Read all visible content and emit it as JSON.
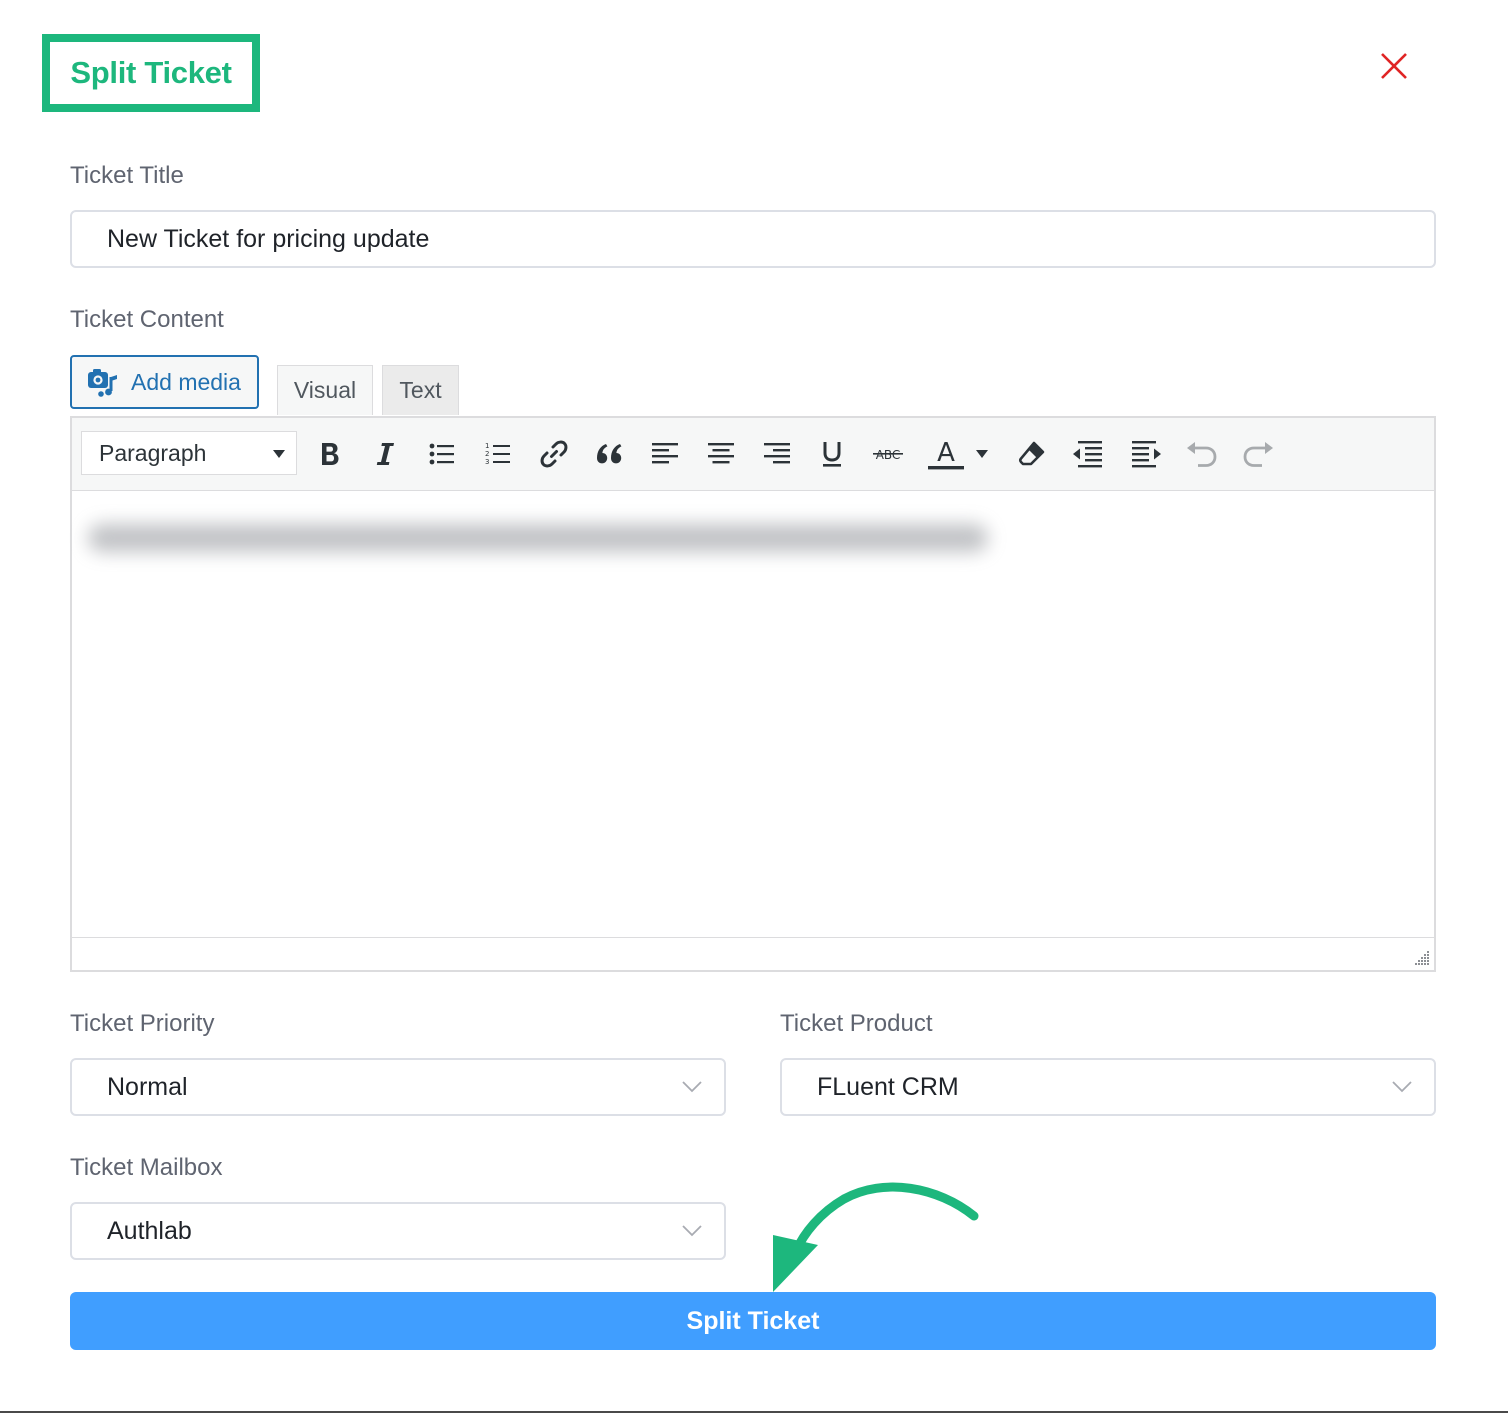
{
  "dialog": {
    "title": "Split Ticket",
    "close_icon": "close-icon",
    "accent_color": "#1db77d",
    "close_color": "#e02424"
  },
  "form": {
    "ticket_title": {
      "label": "Ticket Title",
      "value": "New Ticket for pricing update"
    },
    "ticket_content": {
      "label": "Ticket Content",
      "add_media_label": "Add media",
      "tabs": [
        {
          "label": "Visual",
          "active": true
        },
        {
          "label": "Text",
          "active": false
        }
      ],
      "format_select": {
        "value": "Paragraph"
      },
      "toolbar_icons": [
        "bold-icon",
        "italic-icon",
        "bulleted-list-icon",
        "numbered-list-icon",
        "link-icon",
        "blockquote-icon",
        "align-left-icon",
        "align-center-icon",
        "align-right-icon",
        "underline-icon",
        "strikethrough-icon",
        "text-color-icon",
        "clear-formatting-icon",
        "outdent-icon",
        "indent-icon",
        "undo-icon",
        "redo-icon"
      ],
      "strikethrough_glyph": "ABC",
      "text_color_glyph": "A"
    },
    "ticket_priority": {
      "label": "Ticket Priority",
      "value": "Normal"
    },
    "ticket_product": {
      "label": "Ticket Product",
      "value": "FLuent CRM"
    },
    "ticket_mailbox": {
      "label": "Ticket Mailbox",
      "value": "Authlab"
    },
    "submit_label": "Split Ticket",
    "submit_color": "#409eff"
  }
}
